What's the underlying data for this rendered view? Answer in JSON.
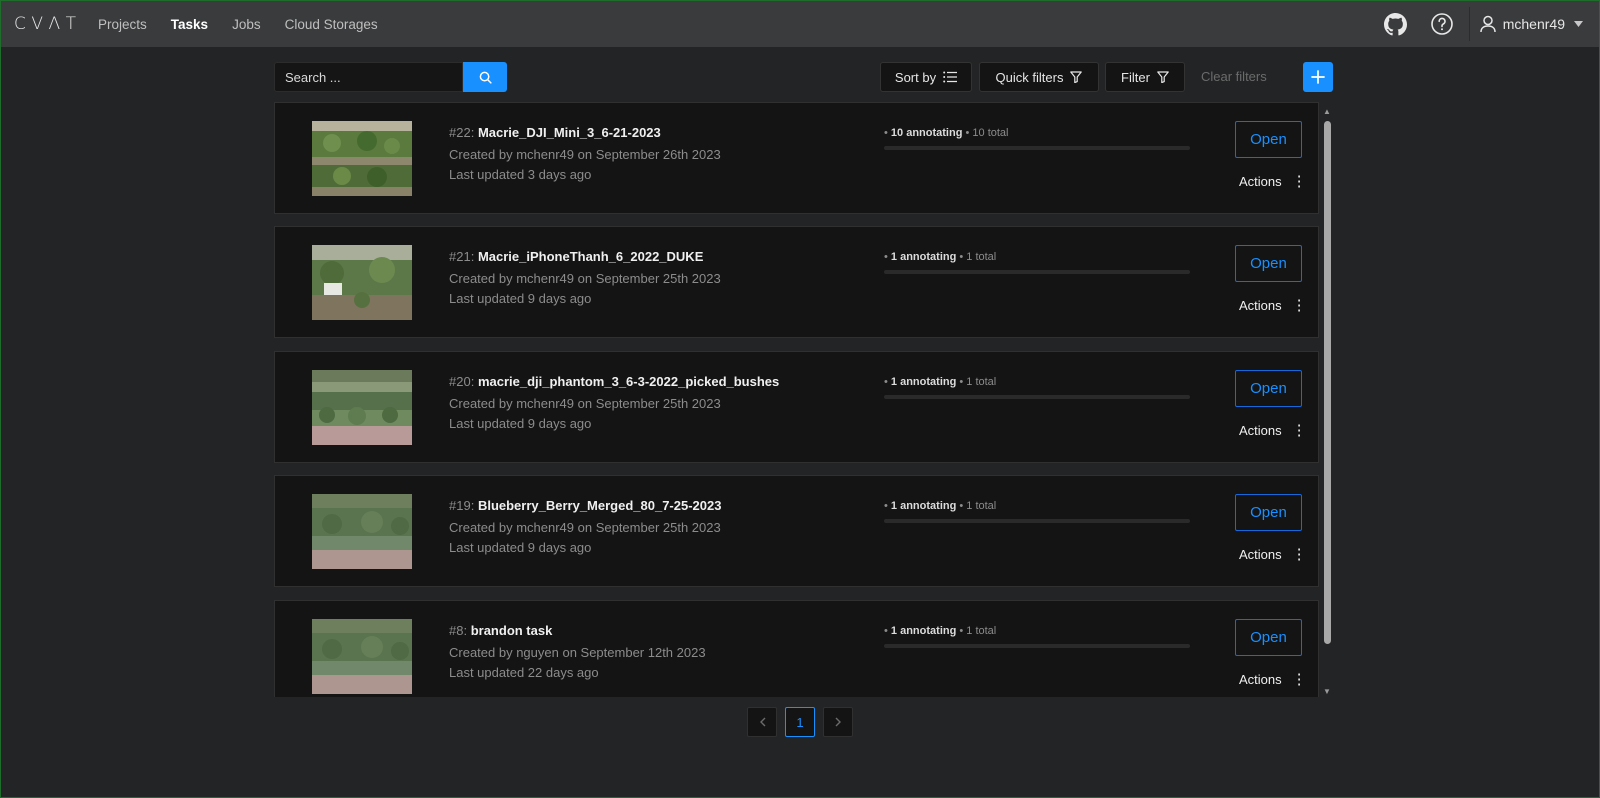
{
  "header": {
    "logo": "CVAT",
    "nav": [
      "Projects",
      "Tasks",
      "Jobs",
      "Cloud Storages"
    ],
    "active_nav": "Tasks",
    "username": "mchenr49"
  },
  "toolbar": {
    "search_placeholder": "Search ...",
    "sort_label": "Sort by",
    "quick_filters_label": "Quick filters",
    "filter_label": "Filter",
    "clear_filters_label": "Clear filters"
  },
  "tasks": [
    {
      "id": "#22:",
      "name": "Macrie_DJI_Mini_3_6-21-2023",
      "created": "Created by mchenr49 on September 26th 2023",
      "updated": "Last updated 3 days ago",
      "annotating": "10 annotating",
      "total": "10 total",
      "progress": 0,
      "open_label": "Open",
      "actions_label": "Actions",
      "thumb": "field-a"
    },
    {
      "id": "#21:",
      "name": "Macrie_iPhoneThanh_6_2022_DUKE",
      "created": "Created by mchenr49 on September 25th 2023",
      "updated": "Last updated 9 days ago",
      "annotating": "1 annotating",
      "total": "1 total",
      "progress": 0,
      "open_label": "Open",
      "actions_label": "Actions",
      "thumb": "field-b"
    },
    {
      "id": "#20:",
      "name": "macrie_dji_phantom_3_6-3-2022_picked_bushes",
      "created": "Created by mchenr49 on September 25th 2023",
      "updated": "Last updated 9 days ago",
      "annotating": "1 annotating",
      "total": "1 total",
      "progress": 0,
      "open_label": "Open",
      "actions_label": "Actions",
      "thumb": "field-c"
    },
    {
      "id": "#19:",
      "name": "Blueberry_Berry_Merged_80_7-25-2023",
      "created": "Created by mchenr49 on September 25th 2023",
      "updated": "Last updated 9 days ago",
      "annotating": "1 annotating",
      "total": "1 total",
      "progress": 0,
      "open_label": "Open",
      "actions_label": "Actions",
      "thumb": "field-c"
    },
    {
      "id": "#8:",
      "name": "brandon task",
      "created": "Created by nguyen on September 12th 2023",
      "updated": "Last updated 22 days ago",
      "annotating": "1 annotating",
      "total": "1 total",
      "progress": 0,
      "open_label": "Open",
      "actions_label": "Actions",
      "thumb": "field-c"
    }
  ],
  "pagination": {
    "current_page": "1"
  },
  "colors": {
    "accent": "#1890ff",
    "header_bg": "#3a3b3d",
    "page_bg": "#232426",
    "card_bg": "#141414"
  }
}
